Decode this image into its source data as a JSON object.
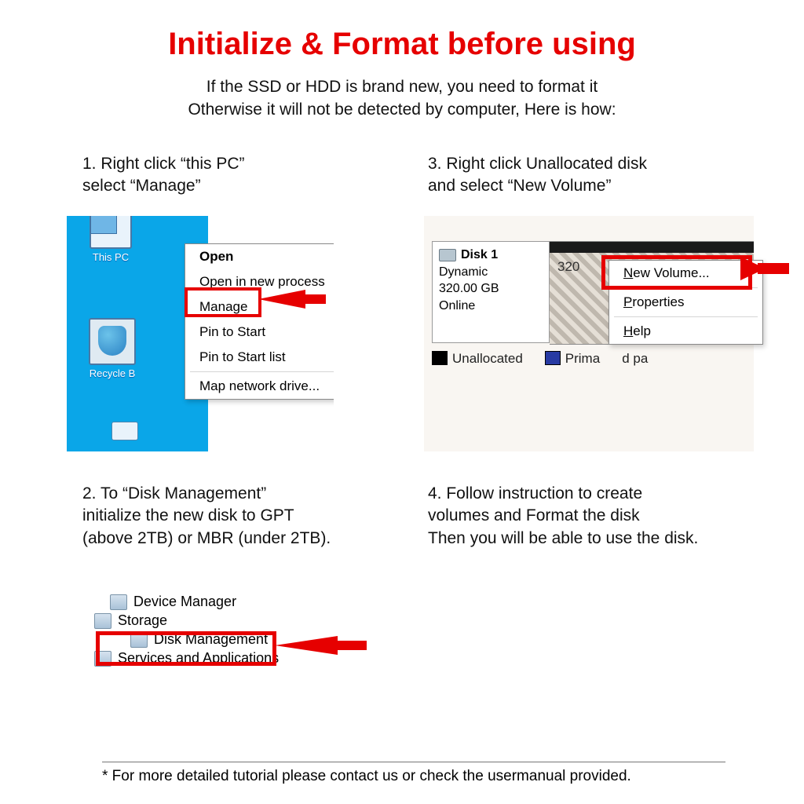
{
  "title": "Initialize & Format before using",
  "subtitle_line1": "If the SSD or HDD is brand new, you need to format it",
  "subtitle_line2": "Otherwise it will not be detected by computer, Here is how:",
  "steps": {
    "s1_line1": "1. Right click “this PC”",
    "s1_line2": "select “Manage”",
    "s2_line1": "2. To “Disk Management”",
    "s2_line2": "initialize the new disk to GPT",
    "s2_line3": "(above 2TB) or MBR (under 2TB).",
    "s3_line1": "3. Right click Unallocated disk",
    "s3_line2": "and select “New Volume”",
    "s4_line1": "4. Follow instruction to create",
    "s4_line2": "volumes and Format the disk",
    "s4_line3": "Then you will be able to use the disk."
  },
  "desktop": {
    "this_pc": "This PC",
    "recycle": "Recycle B"
  },
  "context_menu": {
    "open": "Open",
    "open_new": "Open in new process",
    "manage": "Manage",
    "pin_start": "Pin to Start",
    "pin_start_list": "Pin to Start list",
    "map_drive": "Map network drive..."
  },
  "tree": {
    "device_manager": "Device Manager",
    "storage": "Storage",
    "disk_management": "Disk Management",
    "services": "Services and Applications"
  },
  "disk": {
    "title": "Disk 1",
    "type": "Dynamic",
    "size": "320.00 GB",
    "status": "Online",
    "area_size": "320",
    "legend_unalloc": "Unallocated",
    "legend_primary": "Prima",
    "legend_part": "d pa"
  },
  "popup": {
    "new_volume": "New Volume...",
    "properties": "Properties",
    "help": "Help"
  },
  "footnote": "* For more detailed tutorial please contact us or check the usermanual provided."
}
